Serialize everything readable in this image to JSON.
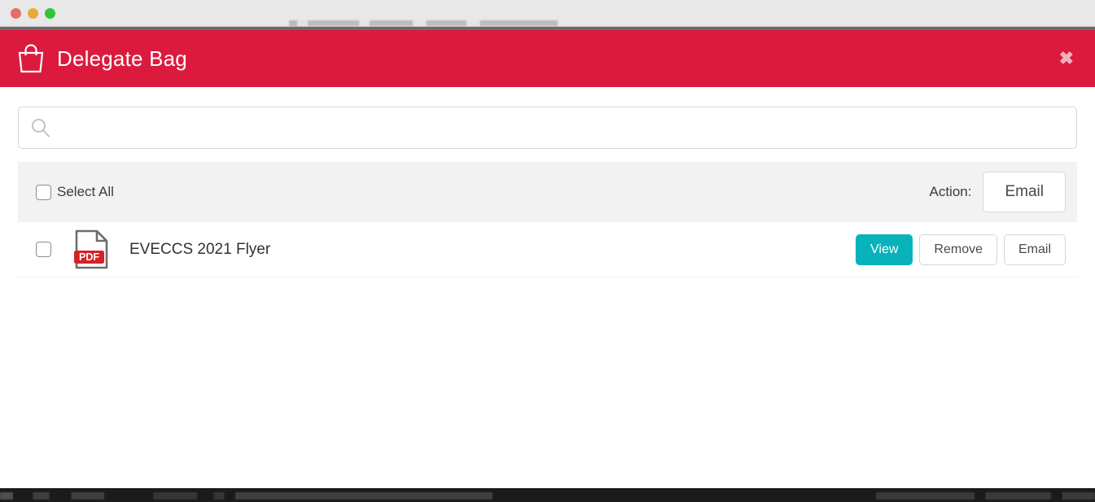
{
  "window": {
    "traffic_lights": [
      "close",
      "minimize",
      "maximize"
    ]
  },
  "modal": {
    "title": "Delegate Bag",
    "bag_icon": "shopping-bag-icon",
    "close_label": "✖",
    "header_color": "#dc1a3d"
  },
  "search": {
    "value": "",
    "placeholder": "",
    "icon": "search-icon"
  },
  "toolbar": {
    "select_all_label": "Select All",
    "select_all_checked": false,
    "action_label": "Action:",
    "action_button_label": "Email"
  },
  "files": {
    "columns": [
      "select",
      "icon",
      "name",
      "actions"
    ],
    "rows": [
      {
        "checked": false,
        "icon": "pdf-file-icon",
        "icon_badge": "PDF",
        "name": "EVECCS 2021 Flyer",
        "actions": [
          {
            "label": "View",
            "style": "primary"
          },
          {
            "label": "Remove",
            "style": "outline"
          },
          {
            "label": "Email",
            "style": "outline"
          }
        ]
      }
    ]
  },
  "colors": {
    "brand_red": "#dc1a3d",
    "accent_teal": "#07b2bb",
    "toolbar_gray": "#f2f2f2",
    "pdf_badge_red": "#d62027",
    "close_pink": "#f2b0bd"
  }
}
